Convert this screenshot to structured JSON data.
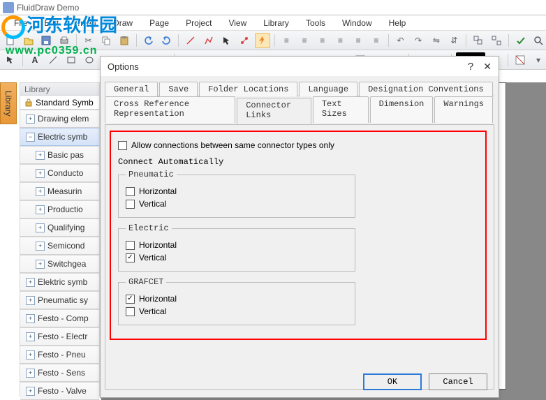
{
  "app": {
    "title": "FluidDraw Demo"
  },
  "watermark": {
    "brand": "河东软件园",
    "url": "www.pc0359.cn"
  },
  "menubar": [
    "File",
    "Edit",
    "Insert",
    "Draw",
    "Page",
    "Project",
    "View",
    "Library",
    "Tools",
    "Window",
    "Help"
  ],
  "library": {
    "title": "Library",
    "root": "Standard Symb",
    "items": [
      {
        "label": "Drawing elem",
        "type": "plus",
        "level": 1
      },
      {
        "label": "Electric symb",
        "type": "minus",
        "level": 1,
        "active": true
      },
      {
        "label": "Basic pas",
        "type": "plus",
        "level": 2
      },
      {
        "label": "Conducto",
        "type": "plus",
        "level": 2
      },
      {
        "label": "Measurin",
        "type": "plus",
        "level": 2
      },
      {
        "label": "Productio",
        "type": "plus",
        "level": 2
      },
      {
        "label": "Qualifying",
        "type": "plus",
        "level": 2
      },
      {
        "label": "Semicond",
        "type": "plus",
        "level": 2
      },
      {
        "label": "Switchgea",
        "type": "plus",
        "level": 2
      },
      {
        "label": "Elektric symb",
        "type": "plus",
        "level": 1
      },
      {
        "label": "Pneumatic sy",
        "type": "plus",
        "level": 1
      },
      {
        "label": "Festo - Comp",
        "type": "plus",
        "level": 1
      },
      {
        "label": "Festo - Electr",
        "type": "plus",
        "level": 1
      },
      {
        "label": "Festo - Pneu",
        "type": "plus",
        "level": 1
      },
      {
        "label": "Festo - Sens",
        "type": "plus",
        "level": 1
      },
      {
        "label": "Festo - Valve",
        "type": "plus",
        "level": 1
      }
    ]
  },
  "vtab": {
    "label": "Library"
  },
  "dialog": {
    "title": "Options",
    "tabs_row1": [
      "General",
      "Save",
      "Folder Locations",
      "Language",
      "Designation Conventions"
    ],
    "tabs_row2": [
      "Cross Reference Representation",
      "Connector Links",
      "Text Sizes",
      "Dimension",
      "Warnings"
    ],
    "active_tab": "Connector Links",
    "allow_only_same_type": {
      "label": "Allow connections between same connector types only",
      "checked": false
    },
    "connect_auto_label": "Connect Automatically",
    "groups": {
      "pneumatic": {
        "legend": "Pneumatic",
        "horizontal": {
          "label": "Horizontal",
          "checked": false
        },
        "vertical": {
          "label": "Vertical",
          "checked": false
        }
      },
      "electric": {
        "legend": "Electric",
        "horizontal": {
          "label": "Horizontal",
          "checked": false
        },
        "vertical": {
          "label": "Vertical",
          "checked": true
        }
      },
      "grafcet": {
        "legend": "GRAFCET",
        "horizontal": {
          "label": "Horizontal",
          "checked": true
        },
        "vertical": {
          "label": "Vertical",
          "checked": false
        }
      }
    },
    "buttons": {
      "ok": "OK",
      "cancel": "Cancel"
    }
  }
}
